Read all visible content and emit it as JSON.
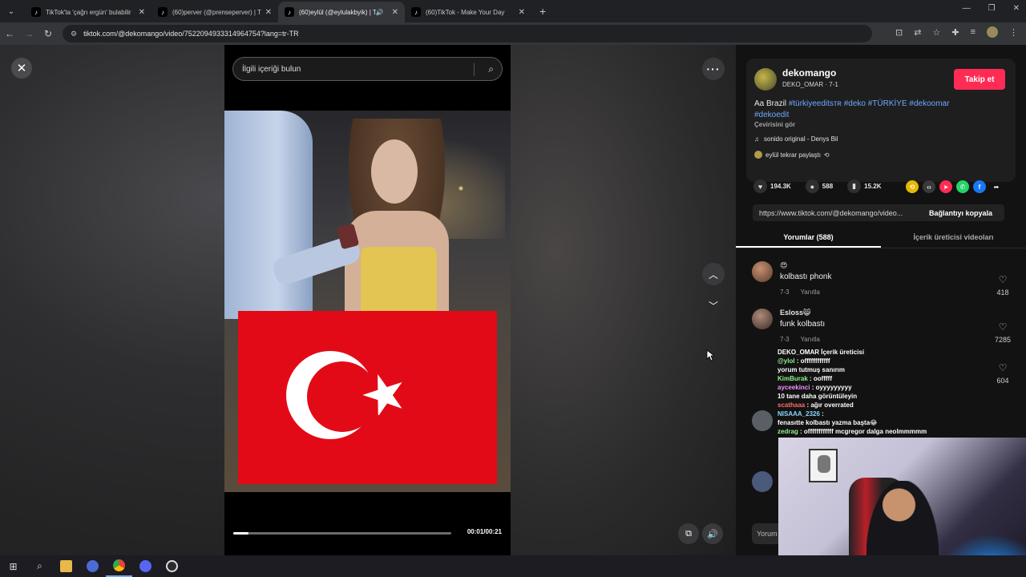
{
  "browser": {
    "tabs": [
      {
        "title": "TikTok'ta 'çağrı ergün' bulabilir",
        "active": false,
        "audio": false
      },
      {
        "title": "(60)perver (@prenseperver) | T",
        "active": false,
        "audio": false
      },
      {
        "title": "(60)eylül (@eylulakbyik) | T",
        "active": true,
        "audio": true
      },
      {
        "title": "(60)TikTok - Make Your Day",
        "active": false,
        "audio": false
      }
    ],
    "url": "tiktok.com/@dekomango/video/7522094933314964754?lang=tr-TR"
  },
  "video": {
    "search_placeholder": "İlgili içeriği bulun",
    "time": "00:01/00:21",
    "progress": 0.07
  },
  "author": {
    "name": "dekomango",
    "subtitle": "DEKO_OMAR · 7-1",
    "follow_label": "Takip et",
    "desc_text": "Aa Brazil ",
    "hashtags_line1": "#türkiyeeditsᴛʀ #deko #TÜRKİYE #dekoomar",
    "hashtags_line2": "#dekoedit",
    "translate_label": "Çevirisini gör",
    "music": "sonido original - Denys Bil",
    "shared_by": "eylül tekrar paylaştı"
  },
  "stats": {
    "likes": "194.3K",
    "comments": "588",
    "saves": "15.2K"
  },
  "link": {
    "url": "https://www.tiktok.com/@dekomango/video...",
    "copy_label": "Bağlantıyı kopyala"
  },
  "tabs": {
    "comments": "Yorumlar (588)",
    "creator_videos": "İçerik üreticisi videoları"
  },
  "comments": [
    {
      "name": "😍",
      "text": "kolbastı phonk",
      "date": "7-3",
      "reply": "Yanıtla",
      "likes": "418"
    },
    {
      "name": "Esloss😸",
      "text": "funk kolbastı",
      "date": "7-3",
      "reply": "Yanıtla",
      "likes": "7285"
    },
    {
      "name": "",
      "text": "",
      "date": "",
      "reply": "",
      "likes": "604"
    }
  ],
  "chat_overlay": [
    {
      "user": "DEKO_OMAR",
      "msg": "İçerik üreticisi",
      "cls": "w"
    },
    {
      "user": "@ylol",
      "msg": ": offffffffffff",
      "cls": "g"
    },
    {
      "user": "",
      "msg": "yorum tutmuş sanırım",
      "cls": "w"
    },
    {
      "user": "KimBurak",
      "msg": ": oofffff",
      "cls": "g"
    },
    {
      "user": "ayceekinci",
      "msg": ": oyyyyyyyyy",
      "cls": "p"
    },
    {
      "user": "10 tane daha görüntüleyin",
      "msg": "",
      "cls": "w"
    },
    {
      "user": "scathaaa",
      "msg": ": ağır overrated",
      "cls": "r"
    },
    {
      "user": "NISAAA_2326",
      "msg": ":",
      "cls": "n"
    },
    {
      "user": "fenasıtte kolbastı yazma başta😂",
      "msg": "",
      "cls": "w"
    },
    {
      "user": "zedrag",
      "msg": ": offffffffffff mcgregor dalga neolmmmmm",
      "cls": "g"
    }
  ],
  "reply_placeholder": "Yorum",
  "colors": {
    "accent": "#fe2c55",
    "hashtag": "#6ea8ff",
    "flag_red": "#e30a17"
  }
}
